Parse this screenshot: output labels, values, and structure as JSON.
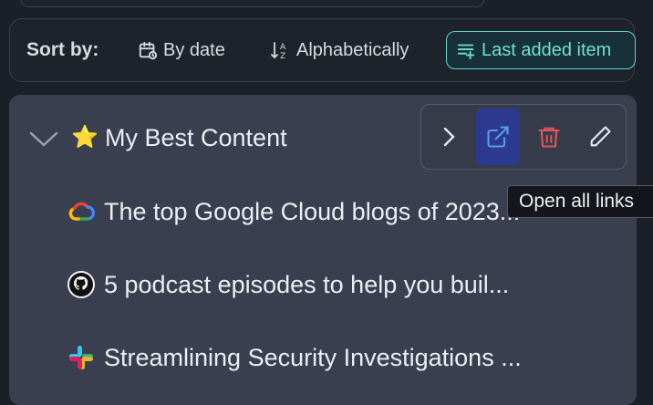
{
  "sort": {
    "label": "Sort by:",
    "options": [
      {
        "label": "By date",
        "icon": "calendar-icon"
      },
      {
        "label": "Alphabetically",
        "icon": "sort-az-icon"
      },
      {
        "label": "Last added item",
        "icon": "list-add-icon",
        "active": true
      }
    ]
  },
  "group": {
    "emoji": "⭐",
    "title": "My Best Content",
    "actions": {
      "expand": "chevron-right-icon",
      "open_all": "external-link-icon",
      "delete": "trash-icon",
      "edit": "pencil-icon"
    }
  },
  "tooltip": "Open all links",
  "links": [
    {
      "icon": "google-cloud-icon",
      "text": "The top Google Cloud blogs of 2023..."
    },
    {
      "icon": "github-icon",
      "text": "5 podcast episodes to help you buil..."
    },
    {
      "icon": "slack-icon",
      "text": "Streamlining Security Investigations ..."
    }
  ],
  "colors": {
    "accent": "#5fd6c8",
    "open_button_bg": "#2b3a8f",
    "delete_red": "#e0565b",
    "star": "#f5c542"
  }
}
